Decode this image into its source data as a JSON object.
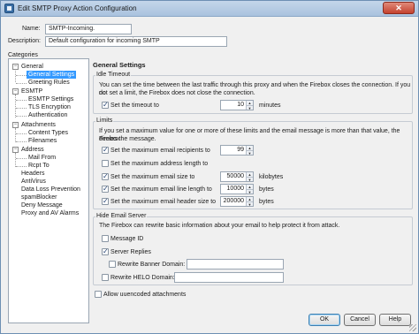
{
  "window": {
    "title": "Edit SMTP Proxy Action Configuration",
    "close_label": "✕"
  },
  "form": {
    "name_label": "Name:",
    "name_value": "SMTP-Incoming.",
    "description_label": "Description:",
    "description_value": "Default configuration for incoming SMTP"
  },
  "categories": {
    "label": "Categories",
    "items": [
      {
        "label": "General",
        "expander": "−"
      },
      {
        "label": "General Settings"
      },
      {
        "label": "Greeting Rules"
      },
      {
        "label": "ESMTP",
        "expander": "−"
      },
      {
        "label": "ESMTP Settings"
      },
      {
        "label": "TLS Encryption"
      },
      {
        "label": "Authentication"
      },
      {
        "label": "Attachments",
        "expander": "−"
      },
      {
        "label": "Content Types"
      },
      {
        "label": "Filenames"
      },
      {
        "label": "Address",
        "expander": "−"
      },
      {
        "label": "Mail From"
      },
      {
        "label": "Rcpt To"
      },
      {
        "label": "Headers"
      },
      {
        "label": "AntiVirus"
      },
      {
        "label": "Data Loss Prevention"
      },
      {
        "label": "spamBlocker"
      },
      {
        "label": "Deny Message"
      },
      {
        "label": "Proxy and AV Alarms"
      }
    ]
  },
  "general_settings": {
    "title": "General Settings",
    "idle_timeout": {
      "legend": "Idle Timeout",
      "description_line1": "You can set the time between the last traffic through this proxy and when the Firebox closes the connection. If you do",
      "description_line2": "not set a limit, the Firebox does not close the connection.",
      "set_timeout_label": "Set the timeout to",
      "set_timeout_checked": true,
      "timeout_value": "10",
      "timeout_unit": "minutes"
    },
    "limits": {
      "legend": "Limits",
      "description_line1": "If you set a maximum value for one or more of these limits and the email message is more than that value, the Firebox",
      "description_line2": "denies the message.",
      "rows": [
        {
          "label": "Set the maximum email recipients to",
          "checked": true,
          "value": "99",
          "unit": ""
        },
        {
          "label": "Set the maximum address length to",
          "checked": false,
          "value": "",
          "unit": ""
        },
        {
          "label": "Set the maximum email size to",
          "checked": true,
          "value": "50000",
          "unit": "kilobytes"
        },
        {
          "label": "Set the maximum email line length to",
          "checked": true,
          "value": "10000",
          "unit": "bytes"
        },
        {
          "label": "Set the maximum email header size to",
          "checked": true,
          "value": "200000",
          "unit": "bytes"
        }
      ]
    },
    "hide_email_server": {
      "legend": "Hide Email Server",
      "description": "The Firebox can rewrite basic information about your email to help protect it from attack.",
      "message_id_label": "Message ID",
      "message_id_checked": false,
      "server_replies_label": "Server Replies",
      "server_replies_checked": true,
      "rewrite_banner_label": "Rewrite Banner Domain:",
      "rewrite_banner_checked": false,
      "rewrite_banner_value": "",
      "rewrite_helo_label": "Rewrite HELO Domain:",
      "rewrite_helo_checked": false,
      "rewrite_helo_value": ""
    },
    "allow_uuencoded_label": "Allow uuencoded attachments",
    "allow_uuencoded_checked": false
  },
  "buttons": {
    "ok": "OK",
    "cancel": "Cancel",
    "help": "Help"
  }
}
